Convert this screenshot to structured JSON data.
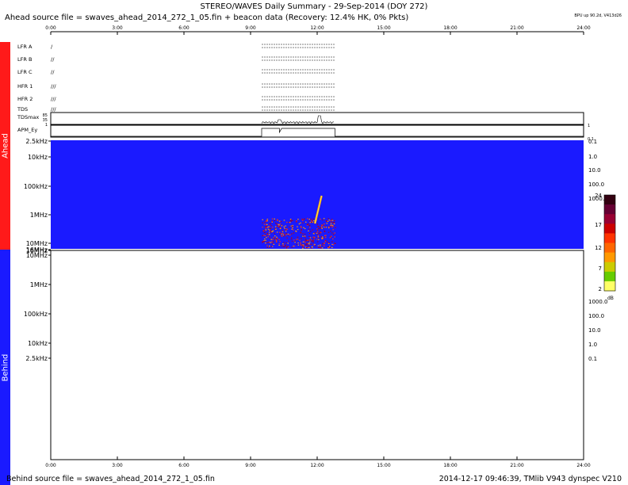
{
  "header": {
    "title": "STEREO/WAVES Daily Summary - 29-Sep-2014 (DOY 272)",
    "subtitle": "Ahead source file = swaves_ahead_2014_272_1_05.fin + beacon data (Recovery: 12.4% HK,   0% Pkts)",
    "bpu": "BPU up 90.2d, V413d26"
  },
  "footer": {
    "left": "Behind source file = swaves_ahead_2014_272_1_05.fin",
    "right": "2014-12-17 09:46:39, TMlib V943 dynspec V210"
  },
  "sidebar": {
    "ahead": "Ahead",
    "behind": "Behind"
  },
  "colors": {
    "ahead_bar": "#ff1a1a",
    "behind_bar": "#1a1aff",
    "spectrogram_background": "#1a1aff",
    "colorbar": [
      "#ffff66",
      "#66cc00",
      "#ff9900",
      "#ff3300",
      "#cc0000",
      "#990033",
      "#660033",
      "#330011"
    ]
  },
  "chart_data": [
    {
      "type": "table",
      "name": "housekeeping-status",
      "x_ticks": [
        "0:00",
        "3:00",
        "6:00",
        "9:00",
        "12:00",
        "15:00",
        "18:00",
        "21:00",
        "24:00"
      ],
      "rows": [
        "LFR A",
        "LFR B",
        "LFR C",
        "HFR 1",
        "HFR 2",
        "TDS",
        "TDSmax",
        "APM_Ey"
      ],
      "tdsmax_ticks": [
        "85",
        "35",
        "1"
      ],
      "right_ticks": [
        "1",
        "0.1"
      ],
      "data_span_hours": [
        9.5,
        12.8
      ]
    },
    {
      "type": "heatmap",
      "name": "ahead-dynamic-spectrum",
      "xlim": [
        0,
        24
      ],
      "y_ticks_left": [
        "2.5kHz",
        "10kHz",
        "100kHz",
        "1MHz",
        "10MHz",
        "16MHz"
      ],
      "y_ticks_right": [
        "0.1",
        "1.0",
        "10.0",
        "100.0",
        "1000.0"
      ],
      "colorbar_ticks": [
        "24",
        "17",
        "12",
        "7",
        "2"
      ],
      "colorbar_unit": "dB",
      "burst": {
        "start_hour": 11.9,
        "end_hour": 12.2,
        "freq_high": "10MHz",
        "freq_low": "100kHz"
      },
      "activity_hours": [
        9.5,
        12.8
      ]
    },
    {
      "type": "heatmap",
      "name": "behind-dynamic-spectrum",
      "xlim": [
        0,
        24
      ],
      "y_ticks_left": [
        "16MHz",
        "10MHz",
        "1MHz",
        "100kHz",
        "10kHz",
        "2.5kHz"
      ],
      "y_ticks_right": [
        "1000.0",
        "100.0",
        "10.0",
        "1.0",
        "0.1"
      ],
      "x_ticks": [
        "0:00",
        "3:00",
        "6:00",
        "9:00",
        "12:00",
        "15:00",
        "18:00",
        "21:00",
        "24:00"
      ]
    }
  ]
}
